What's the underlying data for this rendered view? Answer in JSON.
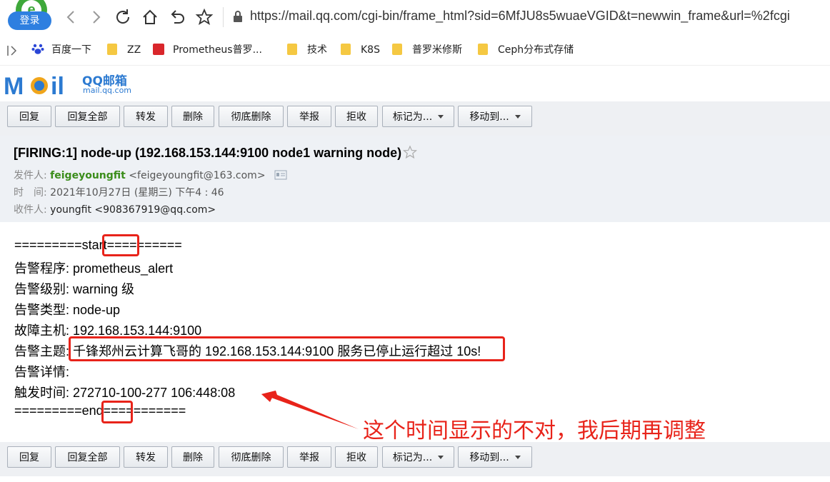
{
  "browser": {
    "login_label": "登录",
    "url": "https://mail.qq.com/cgi-bin/frame_html?sid=6MfJU8s5wuaeVGID&t=newwin_frame&url=%2fcgi"
  },
  "bookmarks": [
    {
      "label": "百度一下",
      "icon": "baidu-icon"
    },
    {
      "label": "ZZ",
      "icon": "folder-icon"
    },
    {
      "label": "Prometheus普罗...",
      "icon": "bookmark-red-icon"
    },
    {
      "label": "技术",
      "icon": "folder-icon"
    },
    {
      "label": "K8S",
      "icon": "folder-icon"
    },
    {
      "label": "普罗米修斯",
      "icon": "folder-icon"
    },
    {
      "label": "Ceph分布式存储",
      "icon": "folder-icon"
    }
  ],
  "mail_logo": {
    "text": "QQ邮箱",
    "domain": "mail.qq.com"
  },
  "toolbar": {
    "reply": "回复",
    "reply_all": "回复全部",
    "forward": "转发",
    "delete": "删除",
    "delete_permanent": "彻底删除",
    "report": "举报",
    "reject": "拒收",
    "mark_as": "标记为...",
    "move_to": "移动到..."
  },
  "mail": {
    "subject": "[FIRING:1] node-up (192.168.153.144:9100 node1 warning node)",
    "from_label": "发件人:",
    "from_name": "feigeyoungfit",
    "from_addr": "<feigeyoungfit@163.com>",
    "time_label": "时　间:",
    "time_value": "2021年10月27日 (星期三) 下午4 : 46",
    "to_label": "收件人:",
    "to_value": "youngfit <908367919@qq.com>"
  },
  "body": {
    "start_prefix": "=========",
    "start_word": "start",
    "start_suffix": "==========",
    "line1": "告警程序: prometheus_alert",
    "line2": "告警级别: warning 级",
    "line3": "告警类型: node-up",
    "line4": "故障主机: 192.168.153.144:9100",
    "line5_label": "告警主题:",
    "line5_value": " 千锋郑州云计算飞哥的 192.168.153.144:9100 服务已停止运行超过 10s!",
    "line6": "告警详情:",
    "line7": "触发时间: 272710-100-277 106:448:08",
    "end_prefix": "=========",
    "end_word": "end",
    "end_suffix": "==========="
  },
  "annotation": "这个时间显示的不对，我后期再调整",
  "colors": {
    "highlight": "#e8231a",
    "toolbar_bg": "#eef0f3",
    "sender": "#3b8d1b"
  }
}
